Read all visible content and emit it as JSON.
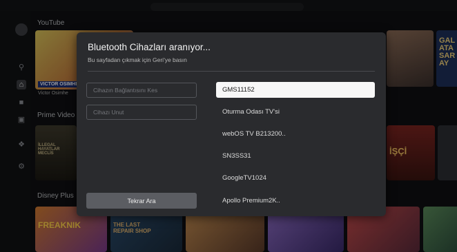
{
  "launcher": {
    "sections": [
      {
        "title": "YouTube"
      },
      {
        "title": "Prime Video"
      },
      {
        "title": "Disney Plus"
      }
    ],
    "thumbs": {
      "yt_main_caption": "VICTOR OSIMHEN",
      "yt_main_label": "Victor Osimhe",
      "yt_right_caption": "GALATASARAY",
      "prime_left_caption": "İLLEGAL HAYATLAR MECLİS",
      "prime_right_caption": "İŞÇİ",
      "disney_first_caption": "FREAKNIK",
      "disney_second_caption": "THE LAST REPAIR SHOP"
    }
  },
  "dialog": {
    "title": "Bluetooth Cihazları aranıyor...",
    "subtitle": "Bu sayfadan çıkmak için Geri'ye basın",
    "buttons": {
      "disconnect": "Cihazın Bağlantısını Kes",
      "forget": "Cihazı Unut",
      "search_again": "Tekrar Ara"
    },
    "devices": [
      {
        "name": "GMS11152",
        "selected": true
      },
      {
        "name": "Oturma Odası TV'si",
        "selected": false
      },
      {
        "name": "webOS TV B213200..",
        "selected": false
      },
      {
        "name": "SN3SS31",
        "selected": false
      },
      {
        "name": "GoogleTV1024",
        "selected": false
      },
      {
        "name": "Apollo Premium2K..",
        "selected": false
      }
    ]
  }
}
